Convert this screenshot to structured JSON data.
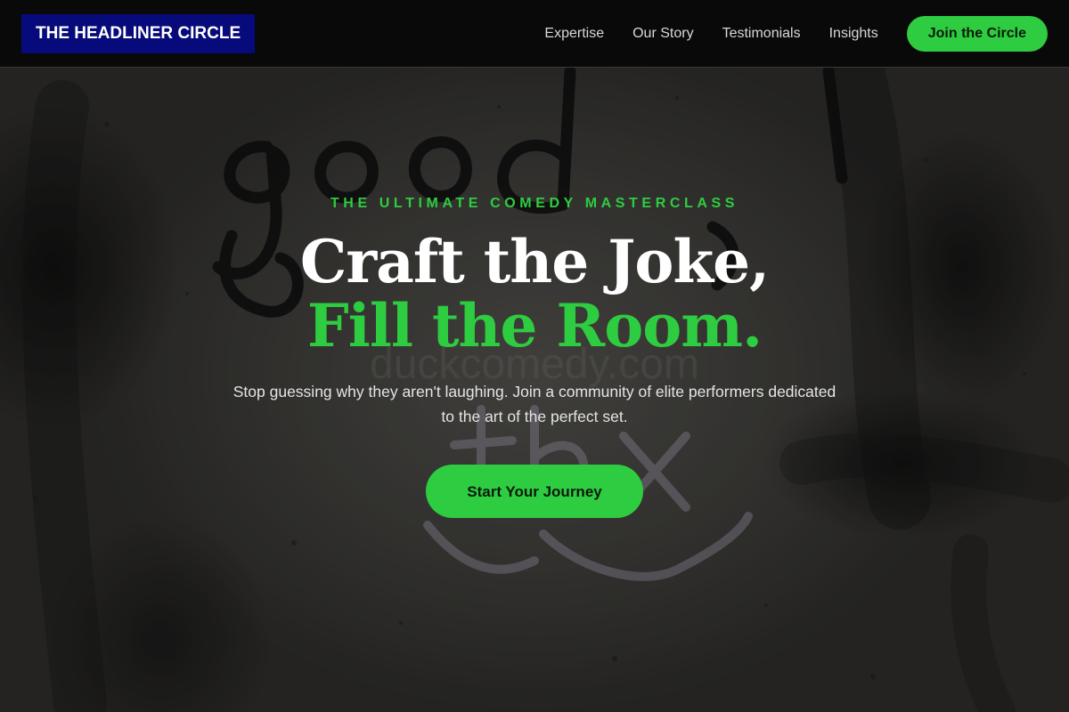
{
  "header": {
    "logo_text": "THE HEADLINER CIRCLE",
    "nav": [
      {
        "label": "Expertise"
      },
      {
        "label": "Our Story"
      },
      {
        "label": "Testimonials"
      },
      {
        "label": "Insights"
      }
    ],
    "cta_label": "Join the Circle"
  },
  "hero": {
    "eyebrow": "THE ULTIMATE COMEDY MASTERCLASS",
    "headline_line1": "Craft the Joke,",
    "headline_line2": "Fill the Room.",
    "subtitle": "Stop guessing why they aren't laughing. Join a community of elite performers dedicated to the art of the perfect set.",
    "cta_label": "Start Your Journey",
    "background_graffiti": [
      "good",
      "duckcomedy.com",
      "thx"
    ]
  },
  "colors": {
    "accent": "#2ecc40",
    "logo_bg": "#070a7a",
    "header_bg": "#080808"
  }
}
